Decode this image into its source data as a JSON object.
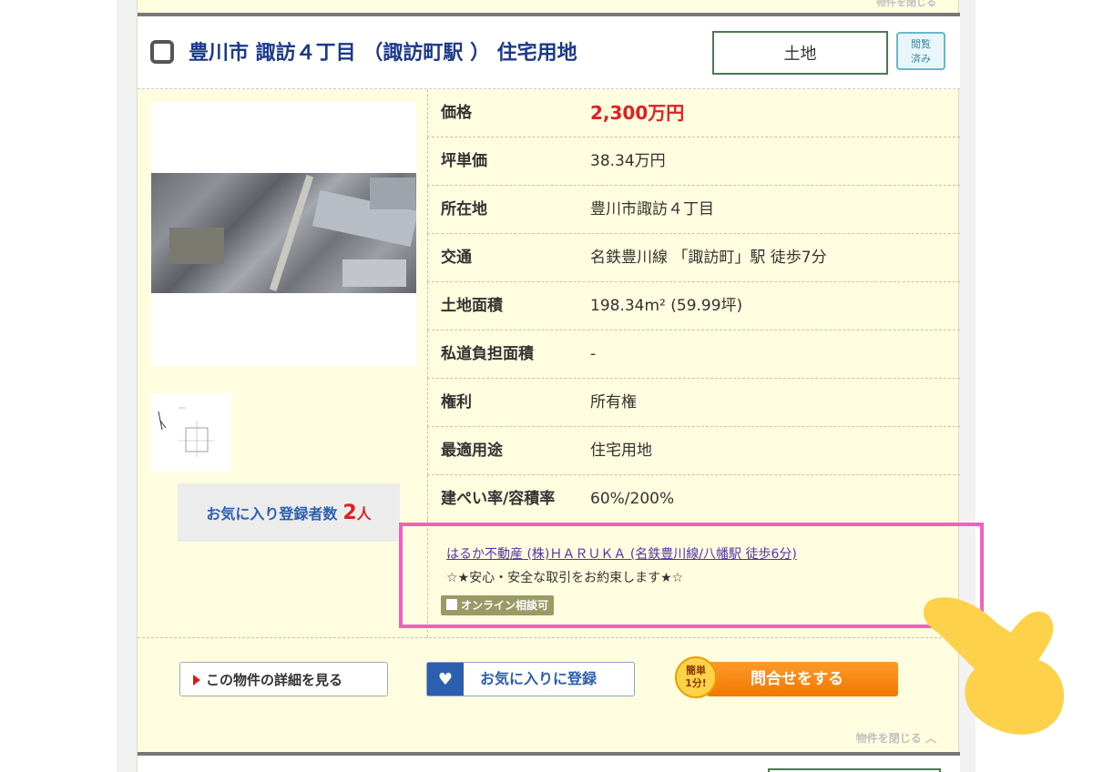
{
  "listing": {
    "close_label_top": "物件を閉じる",
    "title": "豊川市 諏訪４丁目 （諏訪町駅 ） 住宅用地",
    "type": "土地",
    "viewed_badge": "閲覧済み",
    "favorites": {
      "label": "お気に入り登録者数",
      "count": "2",
      "unit": "人"
    },
    "details": [
      {
        "label": "価格",
        "value": "2,300万円",
        "emphasis": true
      },
      {
        "label": "坪単価",
        "value": "38.34万円"
      },
      {
        "label": "所在地",
        "value": "豊川市諏訪４丁目"
      },
      {
        "label": "交通",
        "value": "名鉄豊川線 「諏訪町」駅 徒歩7分"
      },
      {
        "label": "土地面積",
        "value": "198.34m² (59.99坪)"
      },
      {
        "label": "私道負担面積",
        "value": "-"
      },
      {
        "label": "権利",
        "value": "所有権"
      },
      {
        "label": "最適用途",
        "value": "住宅用地"
      },
      {
        "label": "建ぺい率/容積率",
        "value": "60%/200%"
      }
    ],
    "agent": {
      "name_link": "はるか不動産 (株)ＨＡＲＵＫＡ (名鉄豊川線/八幡駅 徒歩6分)",
      "catchphrase": "☆★安心・安全な取引をお約束します★☆",
      "online_badge": "オンライン相談可"
    },
    "buttons": {
      "detail": "この物件の詳細を見る",
      "favorite": "お気に入りに登録",
      "inquiry": "問合せをする",
      "easy_badge_line1": "簡単",
      "easy_badge_line2": "1分!"
    },
    "close_label_bottom": "物件を閉じる"
  },
  "colors": {
    "title": "#1c3a8c",
    "price": "#e02020",
    "highlight": "#f060c0",
    "inquiry": "#f07800",
    "favorite": "#2d5fb0"
  }
}
